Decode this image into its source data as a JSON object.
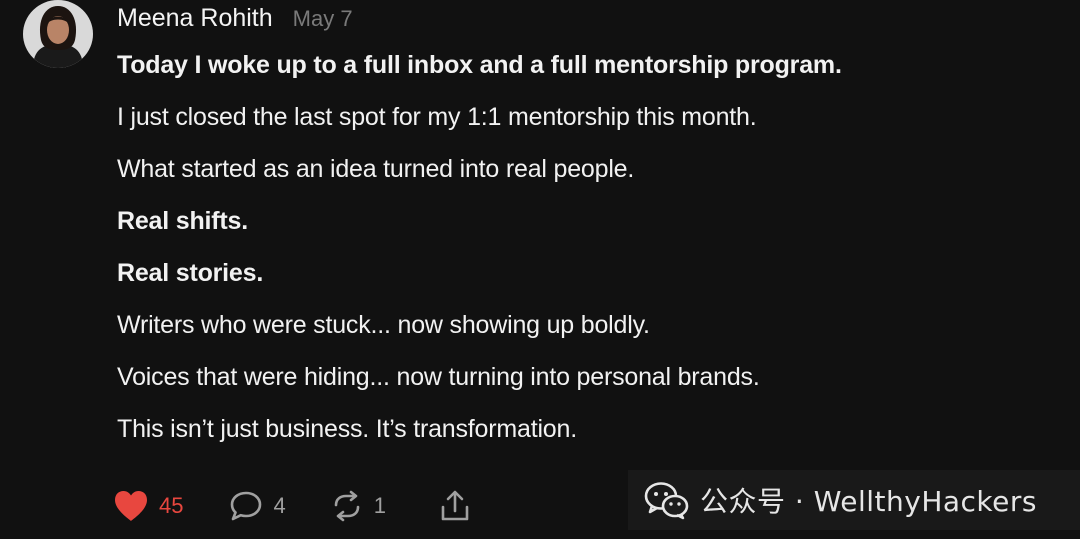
{
  "post": {
    "author": "Meena Rohith",
    "date": "May 7",
    "lines": [
      {
        "text": "Today I woke up to a full inbox and a full mentorship program.",
        "bold": true
      },
      {
        "text": "I just closed the last spot for my 1:1 mentorship this month.",
        "bold": false
      },
      {
        "text": "What started as an idea turned into real people.",
        "bold": false
      },
      {
        "text": "Real shifts.",
        "bold": true
      },
      {
        "text": "Real stories.",
        "bold": true
      },
      {
        "text": "Writers who were stuck... now showing up boldly.",
        "bold": false
      },
      {
        "text": "Voices that were hiding... now turning into personal brands.",
        "bold": false
      },
      {
        "text": "This isn’t just business. It’s transformation.",
        "bold": false
      }
    ]
  },
  "actions": {
    "likes": "45",
    "comments": "4",
    "reposts": "1",
    "like_icon": "heart-icon",
    "comment_icon": "comment-bubble-icon",
    "repost_icon": "repost-icon",
    "share_icon": "share-icon",
    "like_color": "#e8473f"
  },
  "watermark": {
    "text": "公众号 · WellthyHackers",
    "icon": "wechat-icon"
  }
}
